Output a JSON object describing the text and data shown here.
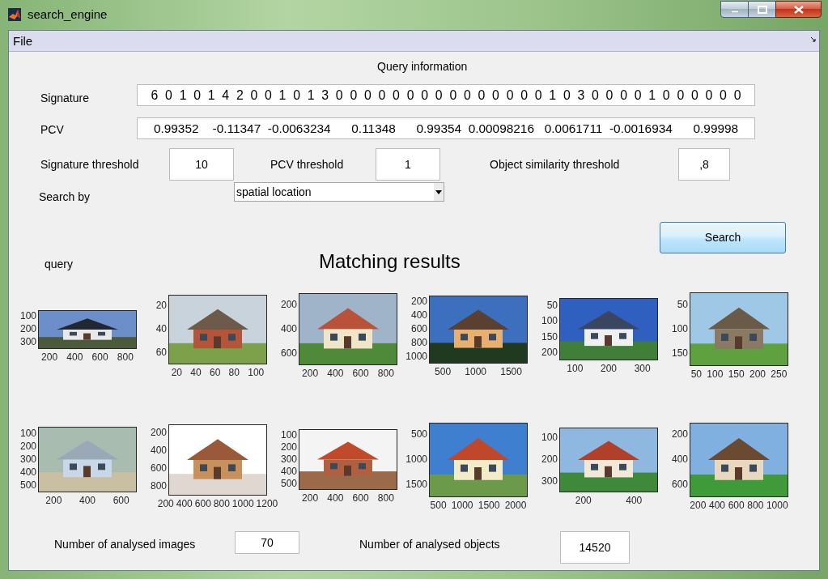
{
  "window": {
    "title": "search_engine"
  },
  "menu": [
    {
      "label": "File"
    }
  ],
  "query_information": {
    "title": "Query information",
    "signature": {
      "label": "Signature",
      "value": "6  0  1  0  1  4  2  0  0  1  0  1  3  0  0  0  0  0  0  0  0  0  0  0  0  0  0  0  1  0  3  0  0  0  0  1  0  0  0  0  0  0"
    },
    "pcv": {
      "label": "PCV",
      "value": "0.99352    -0.11347  -0.0063234      0.11348      0.99354  0.00098216   0.0061711  -0.0016934      0.99998"
    },
    "thresholds": [
      {
        "label": "Signature threshold",
        "value": "10"
      },
      {
        "label": "PCV threshold",
        "value": "1"
      },
      {
        "label": "Object similarity threshold",
        "value": ",8"
      }
    ],
    "search_by": {
      "label": "Search by",
      "value": "spatial location"
    }
  },
  "search_button": {
    "label": "Search"
  },
  "query": {
    "label": "query",
    "image": {
      "yticks": [
        "100",
        "200",
        "300"
      ],
      "xticks": [
        "200",
        "400",
        "600",
        "800"
      ]
    }
  },
  "results": {
    "title": "Matching results",
    "images": [
      {
        "yticks": [
          "20",
          "40",
          "60"
        ],
        "xticks": [
          "20",
          "40",
          "60",
          "80",
          "100"
        ]
      },
      {
        "yticks": [
          "200",
          "400",
          "600"
        ],
        "xticks": [
          "200",
          "400",
          "600",
          "800"
        ]
      },
      {
        "yticks": [
          "200",
          "400",
          "600",
          "800",
          "1000"
        ],
        "xticks": [
          "500",
          "1000",
          "1500"
        ]
      },
      {
        "yticks": [
          "50",
          "100",
          "150",
          "200"
        ],
        "xticks": [
          "100",
          "200",
          "300"
        ]
      },
      {
        "yticks": [
          "50",
          "100",
          "150"
        ],
        "xticks": [
          "50",
          "100",
          "150",
          "200",
          "250"
        ]
      },
      {
        "yticks": [
          "100",
          "200",
          "300",
          "400",
          "500"
        ],
        "xticks": [
          "200",
          "400",
          "600"
        ]
      },
      {
        "yticks": [
          "200",
          "400",
          "600",
          "800"
        ],
        "xticks": [
          "200",
          "400",
          "600",
          "800",
          "1000",
          "1200"
        ]
      },
      {
        "yticks": [
          "100",
          "200",
          "300",
          "400",
          "500"
        ],
        "xticks": [
          "200",
          "400",
          "600",
          "800"
        ]
      },
      {
        "yticks": [
          "500",
          "1000",
          "1500"
        ],
        "xticks": [
          "500",
          "1000",
          "1500",
          "2000"
        ]
      },
      {
        "yticks": [
          "100",
          "200",
          "300"
        ],
        "xticks": [
          "200",
          "400"
        ]
      },
      {
        "yticks": [
          "200",
          "400",
          "600"
        ],
        "xticks": [
          "200",
          "400",
          "600",
          "800",
          "1000"
        ]
      }
    ]
  },
  "statistics": [
    {
      "label": "Number of analysed images",
      "value": "70"
    },
    {
      "label": "Number of analysed objects",
      "value": "14520"
    }
  ]
}
